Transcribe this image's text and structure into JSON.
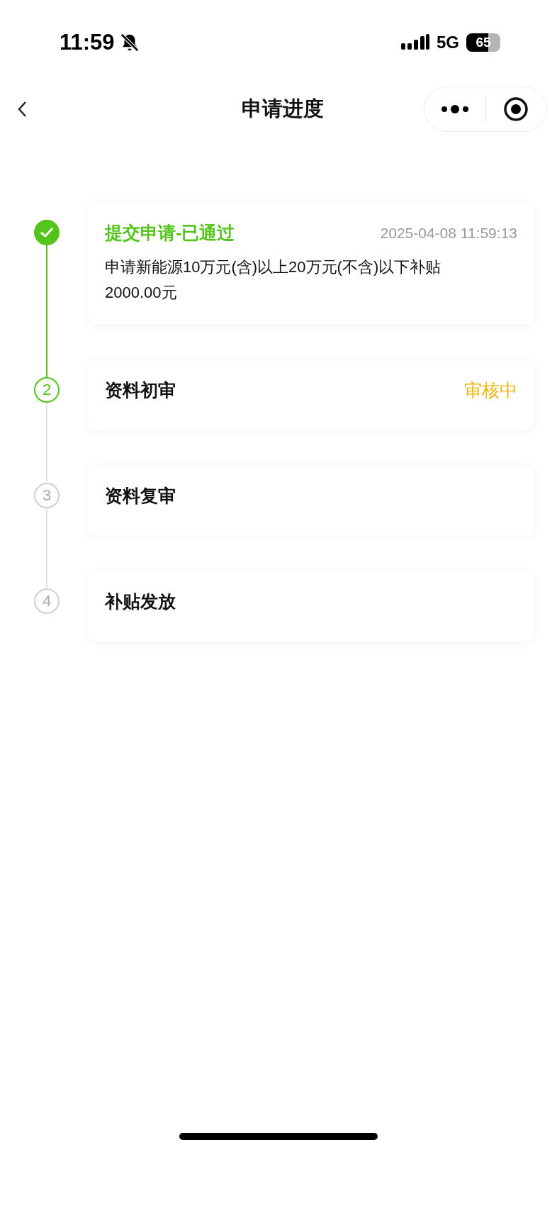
{
  "status_bar": {
    "time": "11:59",
    "network": "5G",
    "battery": "65"
  },
  "nav": {
    "title": "申请进度"
  },
  "steps": [
    {
      "kind": "done",
      "title": "提交申请-已通过",
      "time": "2025-04-08 11:59:13",
      "detail": "申请新能源10万元(含)以上20万元(不含)以下补贴2000.00元"
    },
    {
      "kind": "active",
      "number": "2",
      "title": "资料初审",
      "status": "审核中"
    },
    {
      "kind": "pending",
      "number": "3",
      "title": "资料复审"
    },
    {
      "kind": "pending",
      "number": "4",
      "title": "补贴发放"
    }
  ]
}
